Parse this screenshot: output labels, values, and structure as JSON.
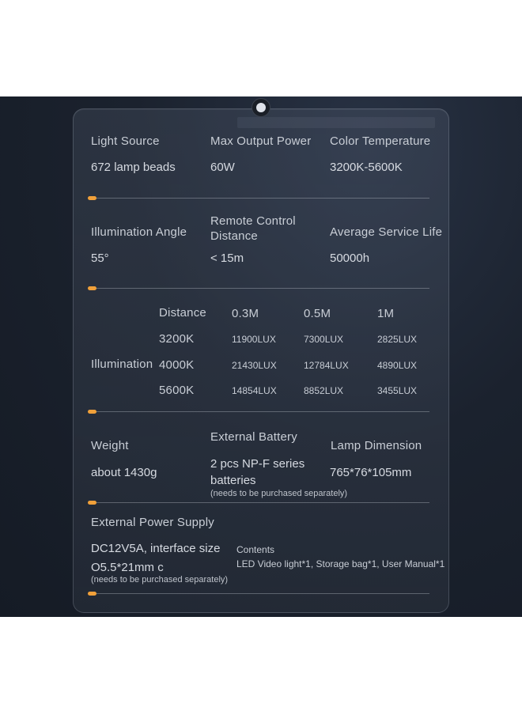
{
  "colors": {
    "accent": "#f0a03a",
    "background": "#1b222e",
    "text": "#c9ced6"
  },
  "section1": {
    "light_source_label": "Light Source",
    "light_source_value": "672 lamp beads",
    "power_label": "Max Output Power",
    "power_value": "60W",
    "color_temp_label": "Color Temperature",
    "color_temp_value": "3200K-5600K"
  },
  "section2": {
    "angle_label": "Illumination Angle",
    "angle_value": "55°",
    "remote_label_line1": "Remote Control",
    "remote_label_line2": "Distance",
    "remote_value": "< 15m",
    "life_label": "Average Service Life",
    "life_value": "50000h"
  },
  "section3": {
    "label": "Illumination",
    "header": [
      "Distance",
      "0.3M",
      "0.5M",
      "1M"
    ],
    "rows": [
      {
        "temp": "3200K",
        "v1": "11900LUX",
        "v2": "7300LUX",
        "v3": "2825LUX"
      },
      {
        "temp": "4000K",
        "v1": "21430LUX",
        "v2": "12784LUX",
        "v3": "4890LUX"
      },
      {
        "temp": "5600K",
        "v1": "14854LUX",
        "v2": "8852LUX",
        "v3": "3455LUX"
      }
    ]
  },
  "section4": {
    "weight_label": "Weight",
    "weight_value": "about 1430g",
    "battery_label": "External Battery",
    "battery_value_line1": "2 pcs NP-F series",
    "battery_value_line2": "batteries",
    "battery_note": "(needs to be purchased separately)",
    "dimension_label": "Lamp Dimension",
    "dimension_value": "765*76*105mm"
  },
  "section5": {
    "power_supply_label": "External Power Supply",
    "power_supply_line1": "DC12V5A, interface size",
    "power_supply_line2": "O5.5*21mm c",
    "power_supply_note": "(needs to be purchased separately)",
    "contents_label": "Contents",
    "contents_value": "LED Video light*1, Storage bag*1, User Manual*1"
  }
}
